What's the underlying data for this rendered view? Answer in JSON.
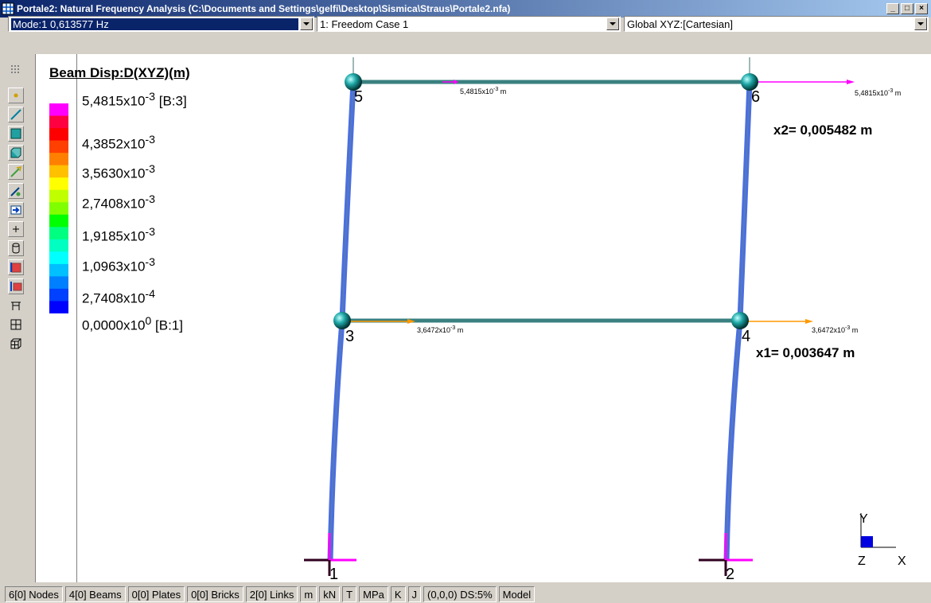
{
  "window": {
    "title": "Portale2: Natural Frequency Analysis (C:\\Documents and Settings\\gelfi\\Desktop\\Sismica\\Straus\\Portale2.nfa)",
    "buttons": [
      "_",
      "□",
      "×"
    ]
  },
  "toolbar": {
    "mode": "Mode:1  0,613577 Hz",
    "freedom_case": "1: Freedom Case 1",
    "coord_system": "Global XYZ:[Cartesian]"
  },
  "left_tools": [
    "grip-icon",
    "node-icon",
    "beam-icon",
    "plate-icon",
    "brick-icon",
    "link-icon",
    "pin-icon",
    "arrow-icon",
    "plus-icon",
    "cylinder-icon",
    "plate-load-icon",
    "beam-load-icon",
    "truss-icon",
    "grid-icon",
    "cube-grid-icon"
  ],
  "legend": {
    "title": "Beam Disp:D(XYZ)(m)",
    "colors": [
      "#ff00ff",
      "#ff0040",
      "#ff0000",
      "#ff4000",
      "#ff8000",
      "#ffc000",
      "#ffff00",
      "#c0ff00",
      "#80ff00",
      "#00ff00",
      "#00ff80",
      "#00ffc0",
      "#00ffff",
      "#00c0ff",
      "#0080ff",
      "#0040ff",
      "#0000ff"
    ],
    "labels": {
      "l0_mant": "5,4815x10",
      "l0_exp": "-3",
      "l0_suffix": " [B:3]",
      "l1_mant": "4,3852x10",
      "l1_exp": "-3",
      "l2_mant": "3,5630x10",
      "l2_exp": "-3",
      "l3_mant": "2,7408x10",
      "l3_exp": "-3",
      "l4_mant": "1,9185x10",
      "l4_exp": "-3",
      "l5_mant": "1,0963x10",
      "l5_exp": "-3",
      "l6_mant": "2,7408x10",
      "l6_exp": "-4",
      "l7_mant": "0,0000x10",
      "l7_exp": "0",
      "l7_suffix": " [B:1]"
    }
  },
  "model": {
    "node_labels": [
      "1",
      "2",
      "3",
      "4",
      "5",
      "6"
    ],
    "disp_top_mant": "5,4815x10",
    "disp_top_exp": "-3",
    "disp_unit": " m",
    "disp_mid_mant": "3,6472x10",
    "disp_mid_exp": "-3",
    "x2_label": "x2= 0,005482  m",
    "x1_label": "x1= 0,003647  m",
    "axis_y": "Y",
    "axis_z": "Z",
    "axis_x": "X"
  },
  "status": [
    "6[0] Nodes",
    "4[0] Beams",
    "0[0] Plates",
    "0[0] Bricks",
    "2[0] Links",
    "m",
    "kN",
    "T",
    "MPa",
    "K",
    "J",
    "(0,0,0)  DS:5%",
    "Model"
  ]
}
